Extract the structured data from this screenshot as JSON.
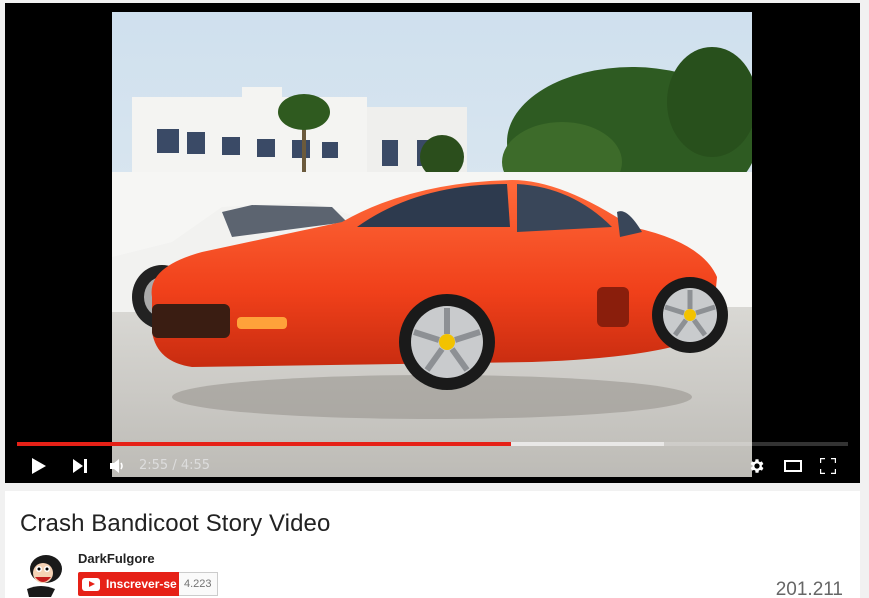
{
  "player": {
    "current_time": "2:55",
    "duration": "4:55",
    "played_fraction": 0.594,
    "buffered_fraction": 0.778,
    "controls": {
      "play_icon": "play-icon",
      "next_icon": "next-icon",
      "volume_icon": "volume-icon",
      "settings_icon": "gear-icon",
      "theater_icon": "theater-mode-icon",
      "fullscreen_icon": "fullscreen-icon"
    },
    "colors": {
      "progress": "#e62117",
      "background": "#000000"
    }
  },
  "video": {
    "title": "Crash Bandicoot Story Video",
    "views": "201.211"
  },
  "channel": {
    "name": "DarkFulgore",
    "subscribe_label": "Inscrever-se",
    "subscriber_count": "4.223",
    "accent": "#e62117"
  }
}
